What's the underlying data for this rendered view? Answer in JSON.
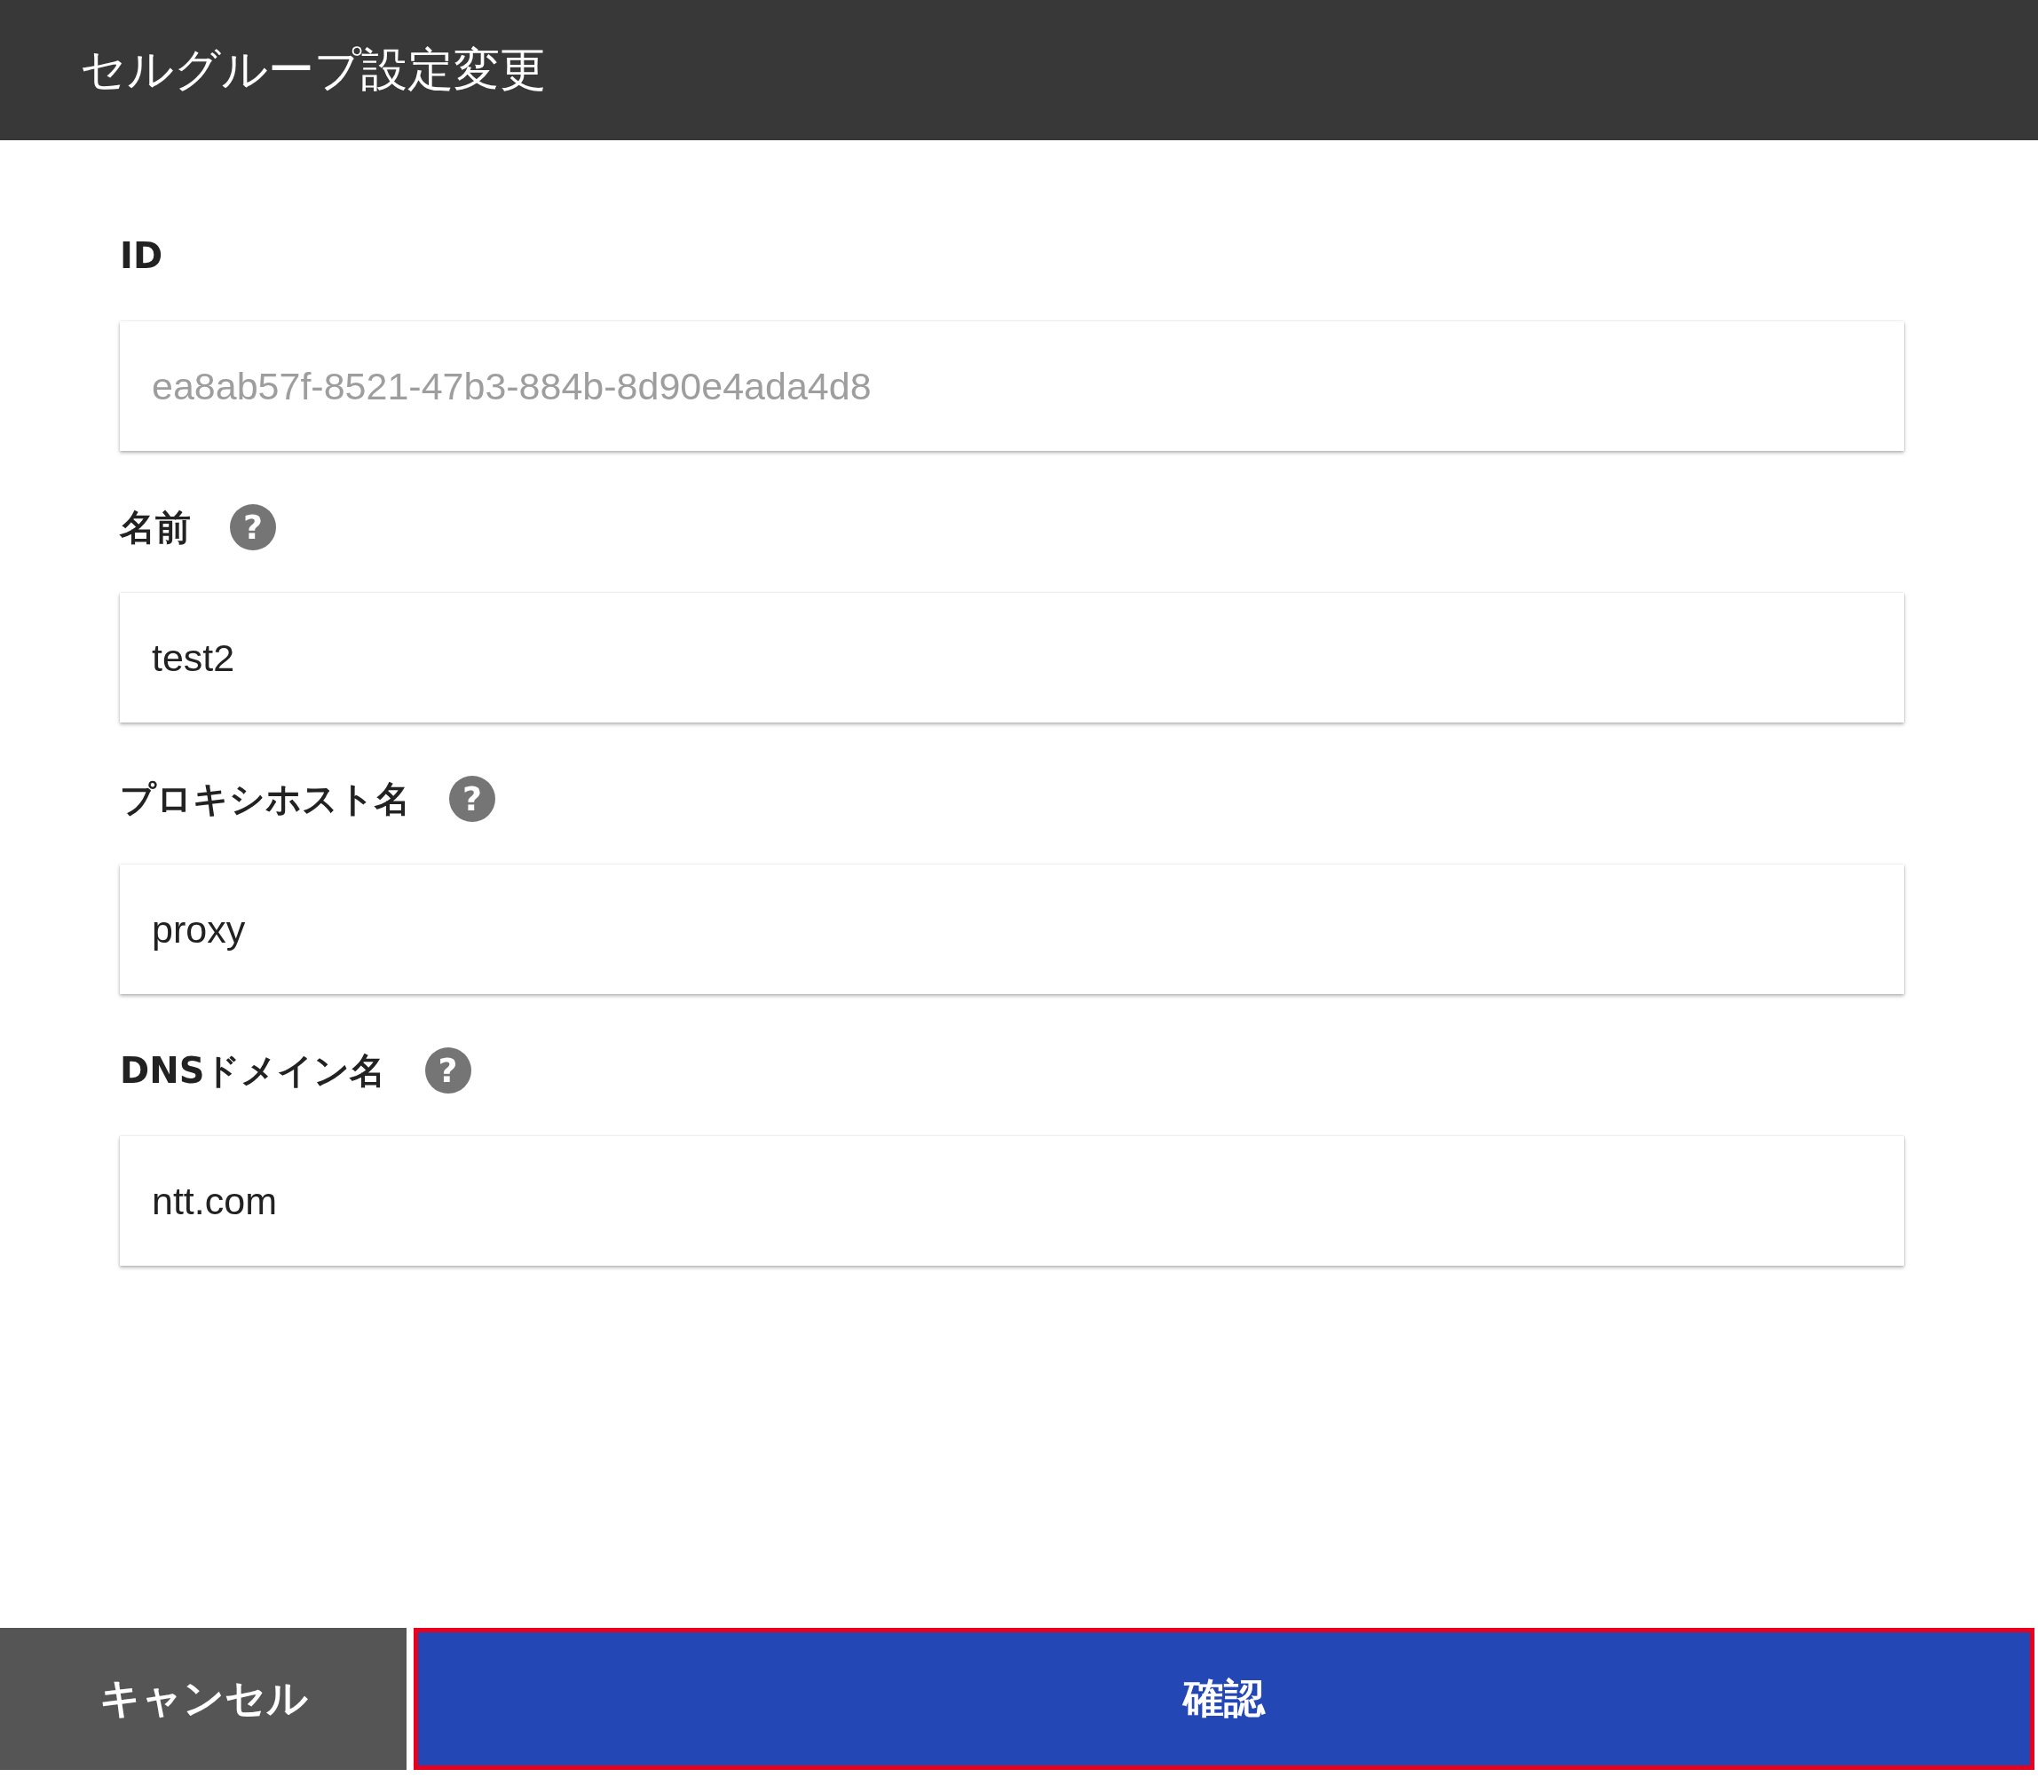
{
  "window": {
    "title": "セルグループ設定変更"
  },
  "fields": [
    {
      "label": "ID",
      "value": "ea8ab57f-8521-47b3-884b-8d90e4ada4d8",
      "disabled": true
    },
    {
      "label": "名前",
      "help_icon": "?",
      "value": "test2",
      "disabled": false
    },
    {
      "label": "プロキシホスト名",
      "help_icon": "?",
      "value": "proxy",
      "disabled": false
    },
    {
      "label": "DNSドメイン名",
      "help_icon": "?",
      "value": "ntt.com",
      "disabled": false
    }
  ],
  "buttons": [
    {
      "kind": "cancel",
      "label": "キャンセル",
      "highlighted": false
    },
    {
      "kind": "confirm",
      "label": "確認",
      "highlighted": true
    }
  ]
}
